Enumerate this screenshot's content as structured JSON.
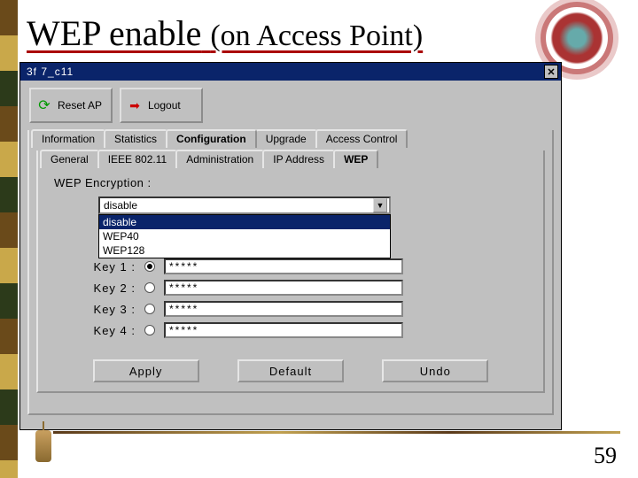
{
  "slide": {
    "title_main": "WEP enable",
    "title_sub": "(on Access Point)",
    "page_number": "59"
  },
  "window": {
    "title": "3f 7_c11",
    "close_glyph": "✕"
  },
  "toolbar": {
    "reset_label": "Reset AP",
    "logout_label": "Logout"
  },
  "tabs_primary": {
    "information": "Information",
    "statistics": "Statistics",
    "configuration": "Configuration",
    "upgrade": "Upgrade",
    "access_control": "Access Control"
  },
  "tabs_secondary": {
    "general": "General",
    "ieee": "IEEE 802.11",
    "admin": "Administration",
    "ip": "IP Address",
    "wep": "WEP"
  },
  "wep_panel": {
    "label": "WEP Encryption :",
    "combo_value": "disable",
    "options": {
      "disable": "disable",
      "wep40": "WEP40",
      "wep128": "WEP128"
    },
    "keys": [
      {
        "label": "Key 1  :",
        "value": "*****",
        "selected": true
      },
      {
        "label": "Key 2 :",
        "value": "*****",
        "selected": false
      },
      {
        "label": "Key 3 :",
        "value": "*****",
        "selected": false
      },
      {
        "label": "Key 4 :",
        "value": "*****",
        "selected": false
      }
    ]
  },
  "buttons": {
    "apply": "Apply",
    "default": "Default",
    "undo": "Undo"
  },
  "icons": {
    "refresh": "⟳",
    "logout": "➡",
    "dropdown": "▼"
  }
}
